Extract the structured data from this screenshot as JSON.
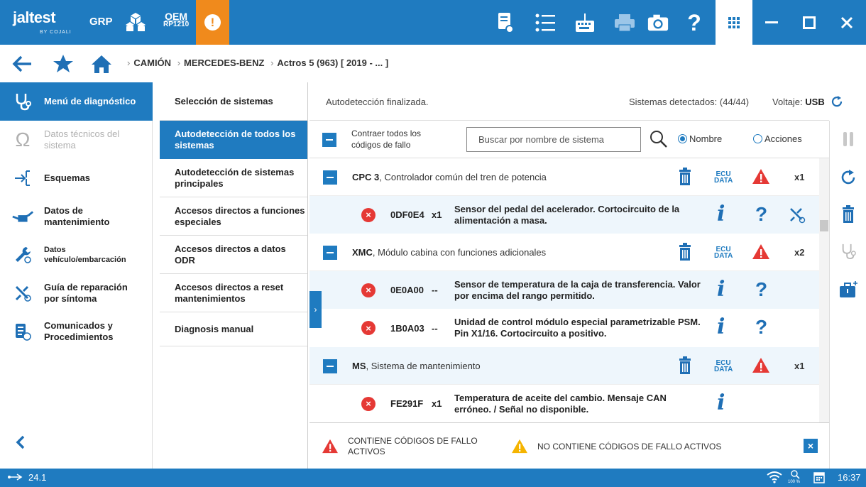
{
  "topbar": {
    "brand": "jaltest",
    "brand_by": "BY COJALI",
    "grp_label": "GRP",
    "oem_line1": "OEM",
    "oem_line2": "RP1210",
    "alert_symbol": "!",
    "icons": [
      "report-icon",
      "list-icon",
      "keyboard-icon",
      "printer-icon",
      "camera-icon",
      "help-icon",
      "apps-grid-icon",
      "minimize-icon",
      "maximize-icon",
      "close-icon"
    ],
    "accent_color": "#1f7bc0",
    "alert_color": "#f08a1c"
  },
  "breadcrumb": {
    "items": [
      "CAMIÓN",
      "MERCEDES-BENZ",
      "Actros 5 (963) [ 2019 - ... ]"
    ]
  },
  "sidebar": {
    "items": [
      {
        "label": "Menú de diagnóstico",
        "icon": "stethoscope-icon"
      },
      {
        "label": "Datos técnicos del sistema",
        "icon": "omega-icon"
      },
      {
        "label": "Esquemas",
        "icon": "schematic-icon"
      },
      {
        "label": "Datos de mantenimiento",
        "icon": "oil-can-icon"
      },
      {
        "label": "Datos vehículo/embarcación",
        "icon": "wrench-globe-icon"
      },
      {
        "label": "Guía de reparación por síntoma",
        "icon": "tools-globe-icon"
      },
      {
        "label": "Comunicados y Procedimientos",
        "icon": "document-globe-icon"
      }
    ]
  },
  "midmenu": {
    "header": "Selección de sistemas",
    "items": [
      "Autodetección de todos los sistemas",
      "Autodetección de sistemas principales",
      "Accesos directos a funciones especiales",
      "Accesos directos a datos ODR",
      "Accesos directos a reset mantenimientos",
      "Diagnosis manual"
    ]
  },
  "main": {
    "status": "Autodetección finalizada.",
    "detected": "Sistemas detectados: (44/44)",
    "voltage_label": "Voltaje:",
    "voltage_value": "USB",
    "collapse_label": "Contraer todos los códigos de fallo",
    "search_placeholder": "Buscar por nombre de sistema",
    "radio_name": "Nombre",
    "radio_actions": "Acciones",
    "ecu_label": "ECU DATA",
    "systems": [
      {
        "code": "CPC 3",
        "name": ", Controlador común del tren de potencia",
        "count": "x1",
        "faults": [
          {
            "id": "0DF0E4",
            "mult": "x1",
            "desc": "Sensor del pedal del acelerador. Cortocircuito de la alimentación a masa."
          }
        ]
      },
      {
        "code": "XMC",
        "name": ", Módulo cabina con funciones adicionales",
        "count": "x2",
        "faults": [
          {
            "id": "0E0A00",
            "mult": "--",
            "desc": "Sensor de temperatura de la caja de transferencia. Valor por encima del rango permitido."
          },
          {
            "id": "1B0A03",
            "mult": "--",
            "desc": "Unidad de control módulo especial parametrizable PSM. Pin X1/16. Cortocircuito a positivo."
          }
        ]
      },
      {
        "code": "MS",
        "name": ", Sistema de mantenimiento",
        "count": "x1",
        "faults": [
          {
            "id": "FE291F",
            "mult": "x1",
            "desc": "Temperatura de aceite del cambio. Mensaje CAN erróneo. / Señal no disponible."
          }
        ]
      }
    ],
    "legend_active": "CONTIENE CÓDIGOS DE FALLO ACTIVOS",
    "legend_inactive": "NO CONTIENE CÓDIGOS DE FALLO ACTIVOS",
    "colors": {
      "error_red": "#e53935",
      "warning_yellow": "#f5b400",
      "info_blue": "#1f6fb5"
    }
  },
  "bottombar": {
    "version": "24.1",
    "zoom": "100 %",
    "time": "16:37"
  }
}
